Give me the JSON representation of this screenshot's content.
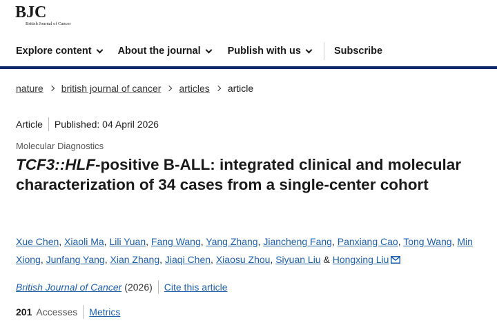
{
  "header": {
    "logo_main": "BJC",
    "logo_sub": "British Journal of Cancer"
  },
  "nav": {
    "items": [
      {
        "label": "Explore content",
        "has_dropdown": true
      },
      {
        "label": "About the journal",
        "has_dropdown": true
      },
      {
        "label": "Publish with us",
        "has_dropdown": true
      },
      {
        "label": "Subscribe",
        "has_dropdown": false
      }
    ],
    "rule_color": "#0d2a6c"
  },
  "breadcrumb": {
    "items": [
      "nature",
      "british journal of cancer",
      "articles"
    ],
    "current": "article"
  },
  "article": {
    "type": "Article",
    "published": "Published: 04 April 2026",
    "subject": "Molecular Diagnostics",
    "title_italic": "TCF3::HLF",
    "title_rest": "-positive B-ALL: integrated clinical and molecular characterization of 34 cases from a single-center cohort",
    "authors": [
      "Xue Chen",
      "Xiaoli Ma",
      "Lili Yuan",
      "Fang Wang",
      "Yang Zhang",
      "Jiancheng Fang",
      "Panxiang Cao",
      "Tong Wang",
      "Min Xiong",
      "Junfang Yang",
      "Xian Zhang",
      "Jiaqi Chen",
      "Xiaosu Zhou",
      "Siyuan Liu",
      "Hongxing Liu"
    ],
    "author_joiner": "&",
    "journal": "British Journal of Cancer",
    "year": "(2026)",
    "cite_label": "Cite this article",
    "accesses_count": "201",
    "accesses_label": "Accesses",
    "metrics_label": "Metrics",
    "link_color": "#1f5fa8"
  }
}
